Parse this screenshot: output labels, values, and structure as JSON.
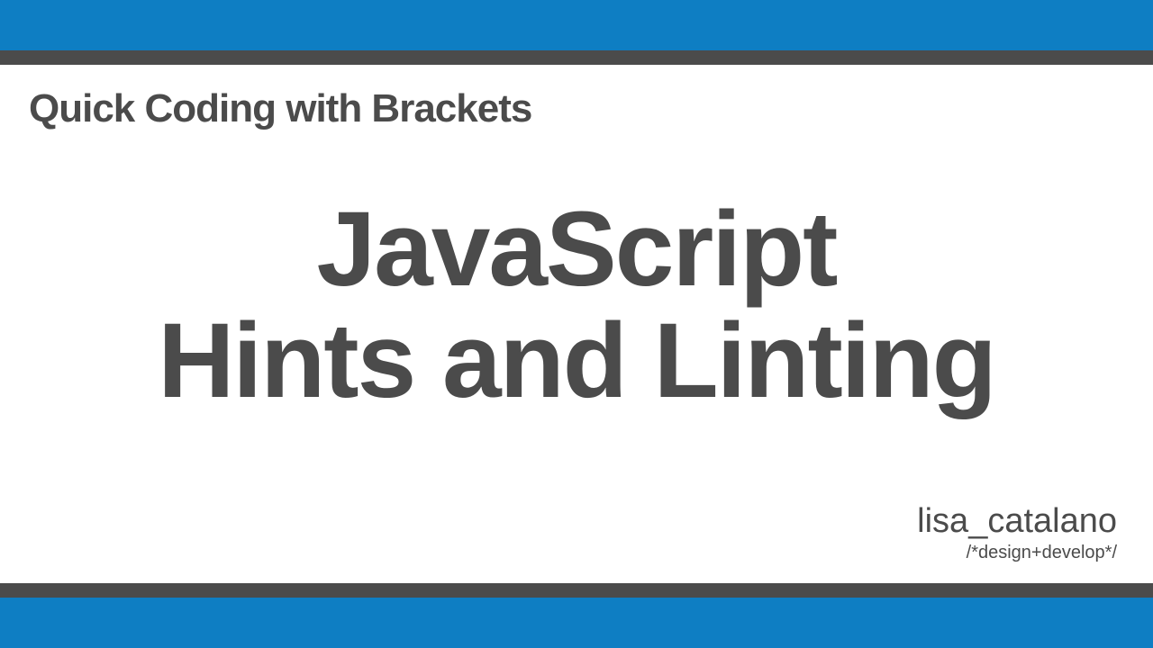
{
  "slide": {
    "series_title": "Quick Coding with Brackets",
    "main_title_line1": "JavaScript",
    "main_title_line2": "Hints and Linting",
    "author_name": "lisa_catalano",
    "author_tagline": "/*design+develop*/"
  },
  "colors": {
    "blue": "#0e7ec3",
    "gray": "#4b4b4b",
    "white": "#ffffff"
  }
}
